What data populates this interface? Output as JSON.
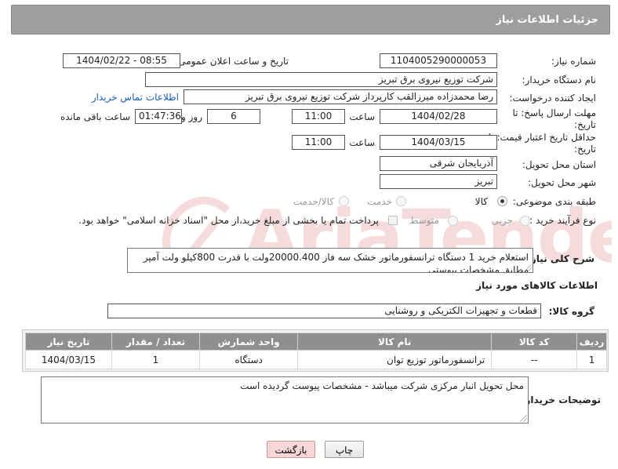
{
  "header": {
    "title": "جزئیات اطلاعات نیاز"
  },
  "fields": {
    "need_number_label": "شماره نیاز:",
    "need_number": "1104005290000053",
    "announce_label": "تاریخ و ساعت اعلان عمومی:",
    "announce_value": "1404/02/22 - 08:55",
    "buyer_org_label": "نام دستگاه خریدار:",
    "buyer_org": "شرکت توزیع نیروی برق تبریز",
    "requester_label": "ایجاد کننده درخواست:",
    "requester": "رضا محمدزاده میرزالقب کارپرداز شرکت توزیع نیروی برق تبریز",
    "buyer_contact_link": "اطلاعات تماس خریدار",
    "deadline_label": "مهلت ارسال پاسخ: تا تاریخ:",
    "deadline_date": "1404/02/28",
    "time_label": "ساعت",
    "deadline_time": "11:00",
    "days_value": "6",
    "days_label": "روز و",
    "remaining_time": "01:47:36",
    "remaining_label": "ساعت باقی مانده",
    "min_validity_label": "حداقل تاریخ اعتبار قیمت: تا تاریخ:",
    "validity_date": "1404/03/15",
    "validity_time": "11:00",
    "province_label": "استان محل تحویل:",
    "province": "آذربایجان شرقی",
    "city_label": "شهر محل تحویل:",
    "city": "تبریز",
    "category_label": "طبقه بندی موضوعی:",
    "category_options": [
      "کالا",
      "خدمت",
      "کالا/خدمت"
    ],
    "process_label": "نوع فرآیند خرید :",
    "process_options": [
      "جزیی",
      "متوسط"
    ],
    "payment_note": "پرداخت تمام یا بخشی از مبلغ خرید،از محل \"اسناد خزانه اسلامی\" خواهد بود."
  },
  "description": {
    "label": "شرح کلی نیاز:",
    "text": "استعلام خرید 1 دستگاه ترانسفورماتور خشک سه فاز 20000.400ولت با قدرت 800کیلو ولت آمپر مطابق مشخصات پیوستی"
  },
  "goods": {
    "section_title": "اطلاعات کالاهای مورد نیاز",
    "group_label": "گروه کالا:",
    "group_value": "قطعات و تجهیزات الکتریکی و روشنایی",
    "columns": [
      "ردیف",
      "کد کالا",
      "نام کالا",
      "واحد شمارش",
      "تعداد / مقدار",
      "تاریخ نیاز"
    ],
    "rows": [
      [
        "1",
        "--",
        "ترانسفورماتور توزیع توان",
        "دستگاه",
        "1",
        "1404/03/15"
      ]
    ]
  },
  "buyer_notes": {
    "label": "توضیحات خریدار:",
    "text": "محل تحویل انبار مرکزی شرکت میباشد - مشخصات پیوست گردیده است"
  },
  "buttons": {
    "print": "چاپ",
    "back": "بازگشت"
  },
  "colors": {
    "header_bg": "#9e9e9e",
    "table_header_bg": "#8f8f8f",
    "link": "#1a5fb4",
    "back_button_bg": "#f6d6d6"
  }
}
